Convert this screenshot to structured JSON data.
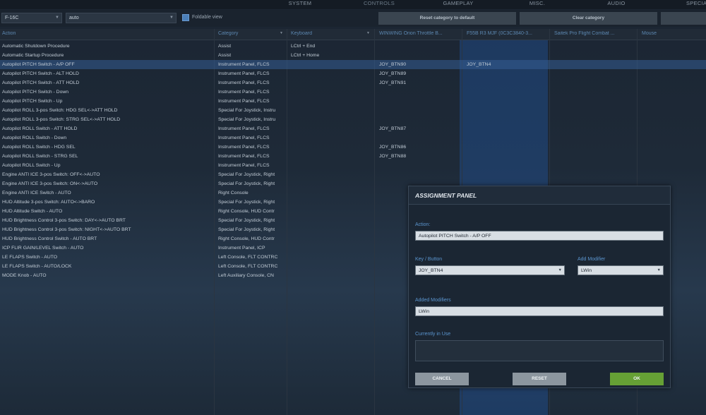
{
  "top_tabs": [
    "SYSTEM",
    "CONTROLS",
    "GAMEPLAY",
    "MISC.",
    "AUDIO",
    "SPECIAL"
  ],
  "active_tab": "CONTROLS",
  "filters": {
    "aircraft": "F-16C",
    "category_mode": "auto",
    "foldable_view_label": "Foldable view",
    "foldable_view_checked": true
  },
  "buttons": {
    "reset_category": "Reset category to default",
    "clear_category": "Clear category"
  },
  "columns": [
    "Action",
    "Category",
    "Keyboard",
    "WINWING Orion Throttle B...",
    "F55B R3 MJF (0C3C3840-3...",
    "Saitek Pro Flight Combat ...",
    "Mouse"
  ],
  "rows": [
    {
      "action": "Automatic Shutdown Procedure",
      "category": "Assist",
      "keyboard": "LCtrl + End",
      "winwing": "",
      "f55b": ""
    },
    {
      "action": "Automatic Startup Procedure",
      "category": "Assist",
      "keyboard": "LCtrl + Home",
      "winwing": "",
      "f55b": ""
    },
    {
      "action": "Autopilot PITCH Switch - A/P OFF",
      "category": "Instrument Panel, FLCS",
      "keyboard": "",
      "winwing": "JOY_BTN90",
      "f55b": "JOY_BTN4",
      "selected": true
    },
    {
      "action": "Autopilot PITCH Switch - ALT HOLD",
      "category": "Instrument Panel, FLCS",
      "keyboard": "",
      "winwing": "JOY_BTN89",
      "f55b": ""
    },
    {
      "action": "Autopilot PITCH Switch - ATT HOLD",
      "category": "Instrument Panel, FLCS",
      "keyboard": "",
      "winwing": "JOY_BTN91",
      "f55b": ""
    },
    {
      "action": "Autopilot PITCH Switch - Down",
      "category": "Instrument Panel, FLCS",
      "keyboard": "",
      "winwing": "",
      "f55b": ""
    },
    {
      "action": "Autopilot PITCH Switch - Up",
      "category": "Instrument Panel, FLCS",
      "keyboard": "",
      "winwing": "",
      "f55b": ""
    },
    {
      "action": "Autopilot ROLL 3-pos Switch: HDG SEL<->ATT HOLD",
      "category": "Special For Joystick, Instru",
      "keyboard": "",
      "winwing": "",
      "f55b": ""
    },
    {
      "action": "Autopilot ROLL 3-pos Switch: STRG SEL<->ATT HOLD",
      "category": "Special For Joystick, Instru",
      "keyboard": "",
      "winwing": "",
      "f55b": ""
    },
    {
      "action": "Autopilot ROLL Switch - ATT HOLD",
      "category": "Instrument Panel, FLCS",
      "keyboard": "",
      "winwing": "JOY_BTN87",
      "f55b": ""
    },
    {
      "action": "Autopilot ROLL Switch - Down",
      "category": "Instrument Panel, FLCS",
      "keyboard": "",
      "winwing": "",
      "f55b": ""
    },
    {
      "action": "Autopilot ROLL Switch - HDG SEL",
      "category": "Instrument Panel, FLCS",
      "keyboard": "",
      "winwing": "JOY_BTN86",
      "f55b": ""
    },
    {
      "action": "Autopilot ROLL Switch - STRG SEL",
      "category": "Instrument Panel, FLCS",
      "keyboard": "",
      "winwing": "JOY_BTN88",
      "f55b": ""
    },
    {
      "action": "Autopilot ROLL Switch - Up",
      "category": "Instrument Panel, FLCS",
      "keyboard": "",
      "winwing": "",
      "f55b": ""
    },
    {
      "action": "Engine ANTI ICE 3-pos Switch: OFF<->AUTO",
      "category": "Special For Joystick, Right",
      "keyboard": "",
      "winwing": "",
      "f55b": ""
    },
    {
      "action": "Engine ANTI ICE 3-pos Switch: ON<->AUTO",
      "category": "Special For Joystick, Right",
      "keyboard": "",
      "winwing": "",
      "f55b": ""
    },
    {
      "action": "Engine ANTI ICE Switch - AUTO",
      "category": "Right Console",
      "keyboard": "",
      "winwing": "",
      "f55b": ""
    },
    {
      "action": "HUD Altitude 3-pos Switch: AUTO<->BARO",
      "category": "Special For Joystick, Right",
      "keyboard": "",
      "winwing": "",
      "f55b": ""
    },
    {
      "action": "HUD Altitude Switch - AUTO",
      "category": "Right Console, HUD Contr",
      "keyboard": "",
      "winwing": "",
      "f55b": ""
    },
    {
      "action": "HUD Brightness Control 3-pos Switch: DAY<->AUTO BRT",
      "category": "Special For Joystick, Right",
      "keyboard": "",
      "winwing": "",
      "f55b": ""
    },
    {
      "action": "HUD Brightness Control 3-pos Switch: NIGHT<->AUTO BRT",
      "category": "Special For Joystick, Right",
      "keyboard": "",
      "winwing": "",
      "f55b": ""
    },
    {
      "action": "HUD Brightness Control Switch - AUTO BRT",
      "category": "Right Console, HUD Contr",
      "keyboard": "",
      "winwing": "",
      "f55b": ""
    },
    {
      "action": "ICP FLIR GAIN/LEVEL Switch - AUTO",
      "category": "Instrument Panel, ICP",
      "keyboard": "",
      "winwing": "",
      "f55b": ""
    },
    {
      "action": "LE FLAPS Switch - AUTO",
      "category": "Left Console, FLT CONTRC",
      "keyboard": "",
      "winwing": "",
      "f55b": ""
    },
    {
      "action": "LE FLAPS Switch - AUTO/LOCK",
      "category": "Left Console, FLT CONTRC",
      "keyboard": "",
      "winwing": "",
      "f55b": ""
    },
    {
      "action": "MODE Knob - AUTO",
      "category": "Left Auxiliary Console, CN",
      "keyboard": "",
      "winwing": "",
      "f55b": ""
    }
  ],
  "panel": {
    "title": "ASSIGNMENT PANEL",
    "action_label": "Action:",
    "action_value": "Autopilot PITCH Switch - A/P OFF",
    "key_label": "Key / Button",
    "key_value": "JOY_BTN4",
    "add_modifier_label": "Add Modifier",
    "add_modifier_value": "LWin",
    "added_modifiers_label": "Added Modifiers",
    "added_modifiers_value": "LWin",
    "in_use_label": "Currently in Use",
    "in_use_value": "",
    "cancel": "CANCEL",
    "reset": "RESET",
    "ok": "OK"
  },
  "colors": {
    "accent": "#5c87b0",
    "ok_button": "#66a035",
    "secondary_button": "#8c969f",
    "highlight_column": "#225296"
  }
}
